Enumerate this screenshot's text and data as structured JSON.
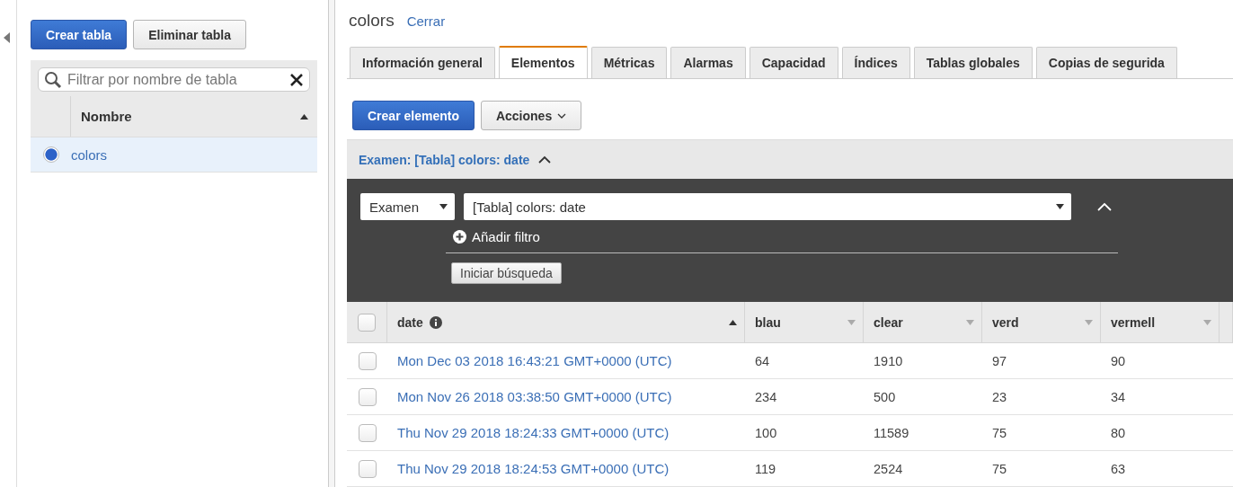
{
  "sidebar": {
    "buttons": [
      {
        "label": "Crear tabla",
        "kind": "primary"
      },
      {
        "label": "Eliminar tabla",
        "kind": "secondary"
      }
    ],
    "filter": {
      "placeholder": "Filtrar por nombre de tabla"
    },
    "column": {
      "label": "Nombre",
      "sorted": true
    },
    "rows": [
      {
        "name": "colors",
        "selected": true
      }
    ]
  },
  "table_title": "colors",
  "close_link": "Cerrar",
  "tabs": [
    {
      "label": "Información general",
      "selected": false
    },
    {
      "label": "Elementos",
      "selected": true
    },
    {
      "label": "Métricas",
      "selected": false
    },
    {
      "label": "Alarmas",
      "selected": false
    },
    {
      "label": "Capacidad",
      "selected": false
    },
    {
      "label": "Índices",
      "selected": false
    },
    {
      "label": "Tablas globales",
      "selected": false
    },
    {
      "label": "Copias de segurida",
      "selected": false
    }
  ],
  "actions": [
    {
      "label": "Crear elemento",
      "kind": "primary"
    },
    {
      "label": "Acciones",
      "kind": "menu"
    }
  ],
  "scan": {
    "title": "Examen: [Tabla] colors: date",
    "expanded": true,
    "mode": "Examen",
    "target": "[Tabla] colors: date",
    "add_filter": "Añadir filtro",
    "search_button": "Iniciar búsqueda"
  },
  "table": {
    "select_all": {
      "checked": false
    },
    "columns": [
      {
        "label": "date",
        "info": true,
        "sorted": true
      },
      {
        "label": "blau",
        "info": false,
        "sorted": false
      },
      {
        "label": "clear",
        "info": false,
        "sorted": false
      },
      {
        "label": "verd",
        "info": false,
        "sorted": false
      },
      {
        "label": "vermell",
        "info": false,
        "sorted": false
      }
    ],
    "rows": [
      {
        "checked": false,
        "cells": [
          "Mon Dec 03 2018 16:43:21 GMT+0000 (UTC)",
          "64",
          "1910",
          "97",
          "90"
        ]
      },
      {
        "checked": false,
        "cells": [
          "Mon Nov 26 2018 03:38:50 GMT+0000 (UTC)",
          "234",
          "500",
          "23",
          "34"
        ]
      },
      {
        "checked": false,
        "cells": [
          "Thu Nov 29 2018 18:24:33 GMT+0000 (UTC)",
          "100",
          "11589",
          "75",
          "80"
        ]
      },
      {
        "checked": false,
        "cells": [
          "Thu Nov 29 2018 18:24:53 GMT+0000 (UTC)",
          "119",
          "2524",
          "75",
          "63"
        ]
      }
    ]
  }
}
